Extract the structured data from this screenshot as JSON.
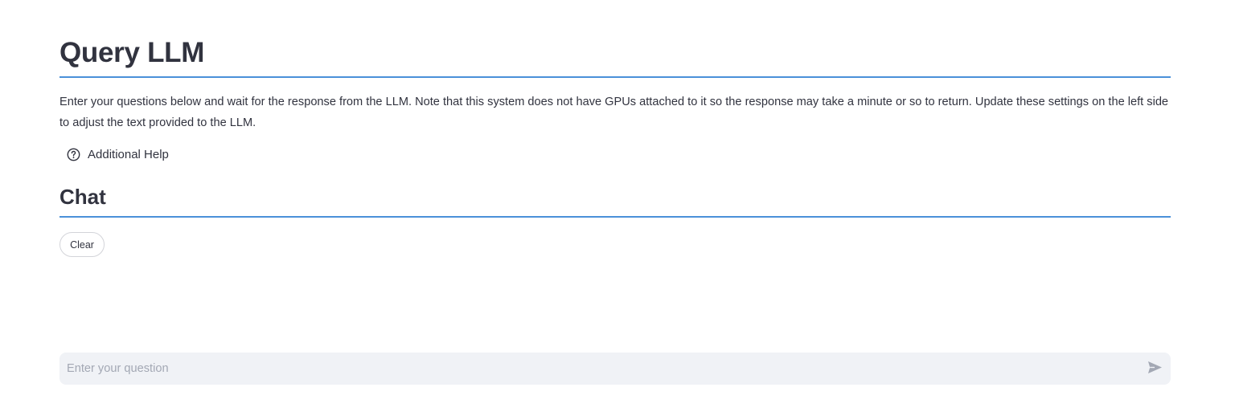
{
  "header": {
    "title": "Query LLM"
  },
  "intro": {
    "text": "Enter your questions below and wait for the response from the LLM. Note that this system does not have GPUs attached to it so the response may take a minute or so to return. Update these settings on the left side to adjust the text provided to the LLM."
  },
  "help": {
    "icon": "question-circle-icon",
    "label": "Additional Help"
  },
  "chat": {
    "title": "Chat",
    "clear_label": "Clear",
    "input": {
      "value": "",
      "placeholder": "Enter your question"
    },
    "send_icon": "send-icon"
  },
  "colors": {
    "divider": "#4a90d9",
    "text": "#31333f",
    "input_bg": "#f0f2f6",
    "placeholder": "#a3a8b4"
  }
}
